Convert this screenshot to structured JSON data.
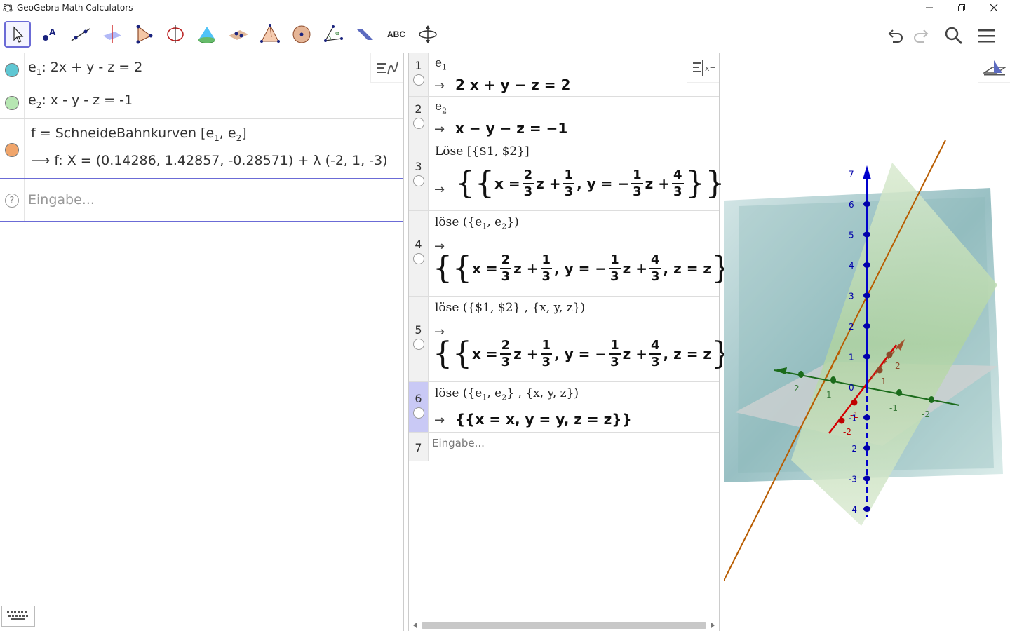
{
  "window": {
    "title": "GeoGebra Math Calculators"
  },
  "toolbar": {
    "text_tool_label": "ABC"
  },
  "algebra": {
    "rows": [
      {
        "name": "e",
        "sub": "1",
        "rest": ": 2x + y - z = 2",
        "color": "#5fc7d3"
      },
      {
        "name": "e",
        "sub": "2",
        "rest": ": x - y - z = -1",
        "color": "#b6e6b2"
      },
      {
        "def_prefix": "f = SchneideBahnkurven [e",
        "def_sub1": "1",
        "def_mid": ", e",
        "def_sub2": "2",
        "def_end": "]",
        "output": "⟶  f: X = (0.14286, 1.42857, -0.28571) + λ (-2, 1, -3)",
        "color": "#f0a56b"
      }
    ],
    "input_placeholder": "Eingabe..."
  },
  "cas": {
    "rows": [
      {
        "num": "1",
        "input_name": "e",
        "input_sub": "1",
        "arrow": "→",
        "output": "2 x + y − z = 2"
      },
      {
        "num": "2",
        "input_name": "e",
        "input_sub": "2",
        "arrow": "→",
        "output": "x − y − z = −1"
      },
      {
        "num": "3",
        "input": "Löse [{$1, $2}]",
        "arrow": "→"
      },
      {
        "num": "4",
        "input_pre": "löse ({e",
        "input_sub1": "1",
        "input_mid": ", e",
        "input_sub2": "2",
        "input_end": "})",
        "arrow": "→"
      },
      {
        "num": "5",
        "input": "löse ({$1, $2} , {x, y, z})",
        "arrow": "→"
      },
      {
        "num": "6",
        "input_pre": "löse ({e",
        "input_sub1": "1",
        "input_mid": ", e",
        "input_sub2": "2",
        "input_end": "} , {x, y, z})",
        "arrow": "→",
        "output": "{{x = x, y = y, z = z}}"
      },
      {
        "num": "7",
        "placeholder": "Eingabe..."
      }
    ],
    "math": {
      "x_eq": "x =",
      "y_eq": ", y = −",
      "z_plus": "z +",
      "z_eq_z": ", z = z",
      "two": "2",
      "one": "1",
      "four": "4",
      "three": "3",
      "open_braces": "{{",
      "close_braces": "}}"
    }
  },
  "graphics3d": {
    "z_axis_labels": [
      "7",
      "6",
      "5",
      "4",
      "3",
      "2",
      "1",
      "0",
      "-1",
      "-2",
      "-3",
      "-4"
    ],
    "x_axis_labels": [
      "2",
      "1",
      "-1",
      "-2"
    ],
    "y_axis_labels": [
      "2",
      "1",
      "-1",
      "-2"
    ],
    "colors": {
      "plane1": "#7fb0b5",
      "plane2": "#b8d8a8",
      "xy_plane": "#cccccc",
      "line": "#b85c00",
      "x_axis": "#d40000",
      "y_axis": "#008000",
      "z_axis": "#0000cc"
    }
  }
}
